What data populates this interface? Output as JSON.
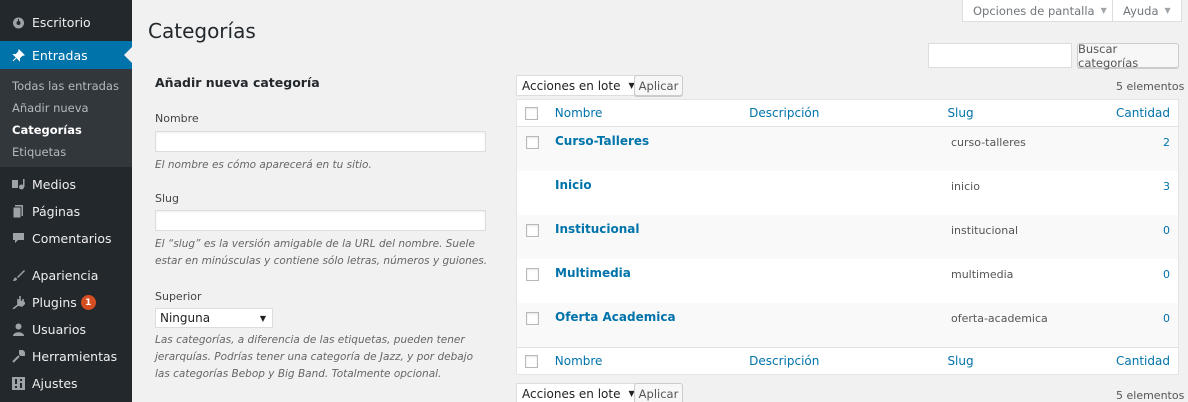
{
  "sidebar": {
    "items": [
      {
        "label": "Escritorio",
        "icon": "dashboard-icon"
      },
      {
        "label": "Entradas",
        "icon": "pin-icon"
      },
      {
        "label": "Medios",
        "icon": "media-icon"
      },
      {
        "label": "Páginas",
        "icon": "pages-icon"
      },
      {
        "label": "Comentarios",
        "icon": "comments-icon"
      },
      {
        "label": "Apariencia",
        "icon": "appearance-icon"
      },
      {
        "label": "Plugins",
        "icon": "plugins-icon",
        "badge": "1"
      },
      {
        "label": "Usuarios",
        "icon": "users-icon"
      },
      {
        "label": "Herramientas",
        "icon": "tools-icon"
      },
      {
        "label": "Ajustes",
        "icon": "settings-icon"
      }
    ],
    "submenu": [
      "Todas las entradas",
      "Añadir nueva",
      "Categorías",
      "Etiquetas"
    ]
  },
  "header": {
    "title": "Categorías",
    "screen_options": "Opciones de pantalla",
    "help": "Ayuda",
    "search_button": "Buscar categorías"
  },
  "form": {
    "heading": "Añadir nueva categoría",
    "name_label": "Nombre",
    "name_help": "El nombre es cómo aparecerá en tu sitio.",
    "slug_label": "Slug",
    "slug_help": "El “slug” es la versión amigable de la URL del nombre. Suele estar en minúsculas y contiene sólo letras, números y guiones.",
    "parent_label": "Superior",
    "parent_value": "Ninguna",
    "parent_help": "Las categorías, a diferencia de las etiquetas, pueden tener jerarquías. Podrías tener una categoría de Jazz, y por debajo las categorías Bebop y Big Band. Totalmente opcional."
  },
  "table": {
    "bulk_actions": "Acciones en lote",
    "apply": "Aplicar",
    "count": "5 elementos",
    "columns": {
      "name": "Nombre",
      "description": "Descripción",
      "slug": "Slug",
      "count": "Cantidad"
    },
    "rows": [
      {
        "name": "Curso-Talleres",
        "slug": "curso-talleres",
        "count": "2"
      },
      {
        "name": "Inicio",
        "slug": "inicio",
        "count": "3"
      },
      {
        "name": "Institucional",
        "slug": "institucional",
        "count": "0"
      },
      {
        "name": "Multimedia",
        "slug": "multimedia",
        "count": "0"
      },
      {
        "name": "Oferta Academica",
        "slug": "oferta-academica",
        "count": "0"
      }
    ]
  },
  "colors": {
    "sidebar_bg": "#23282d",
    "accent": "#0073aa",
    "badge": "#d54e21"
  }
}
